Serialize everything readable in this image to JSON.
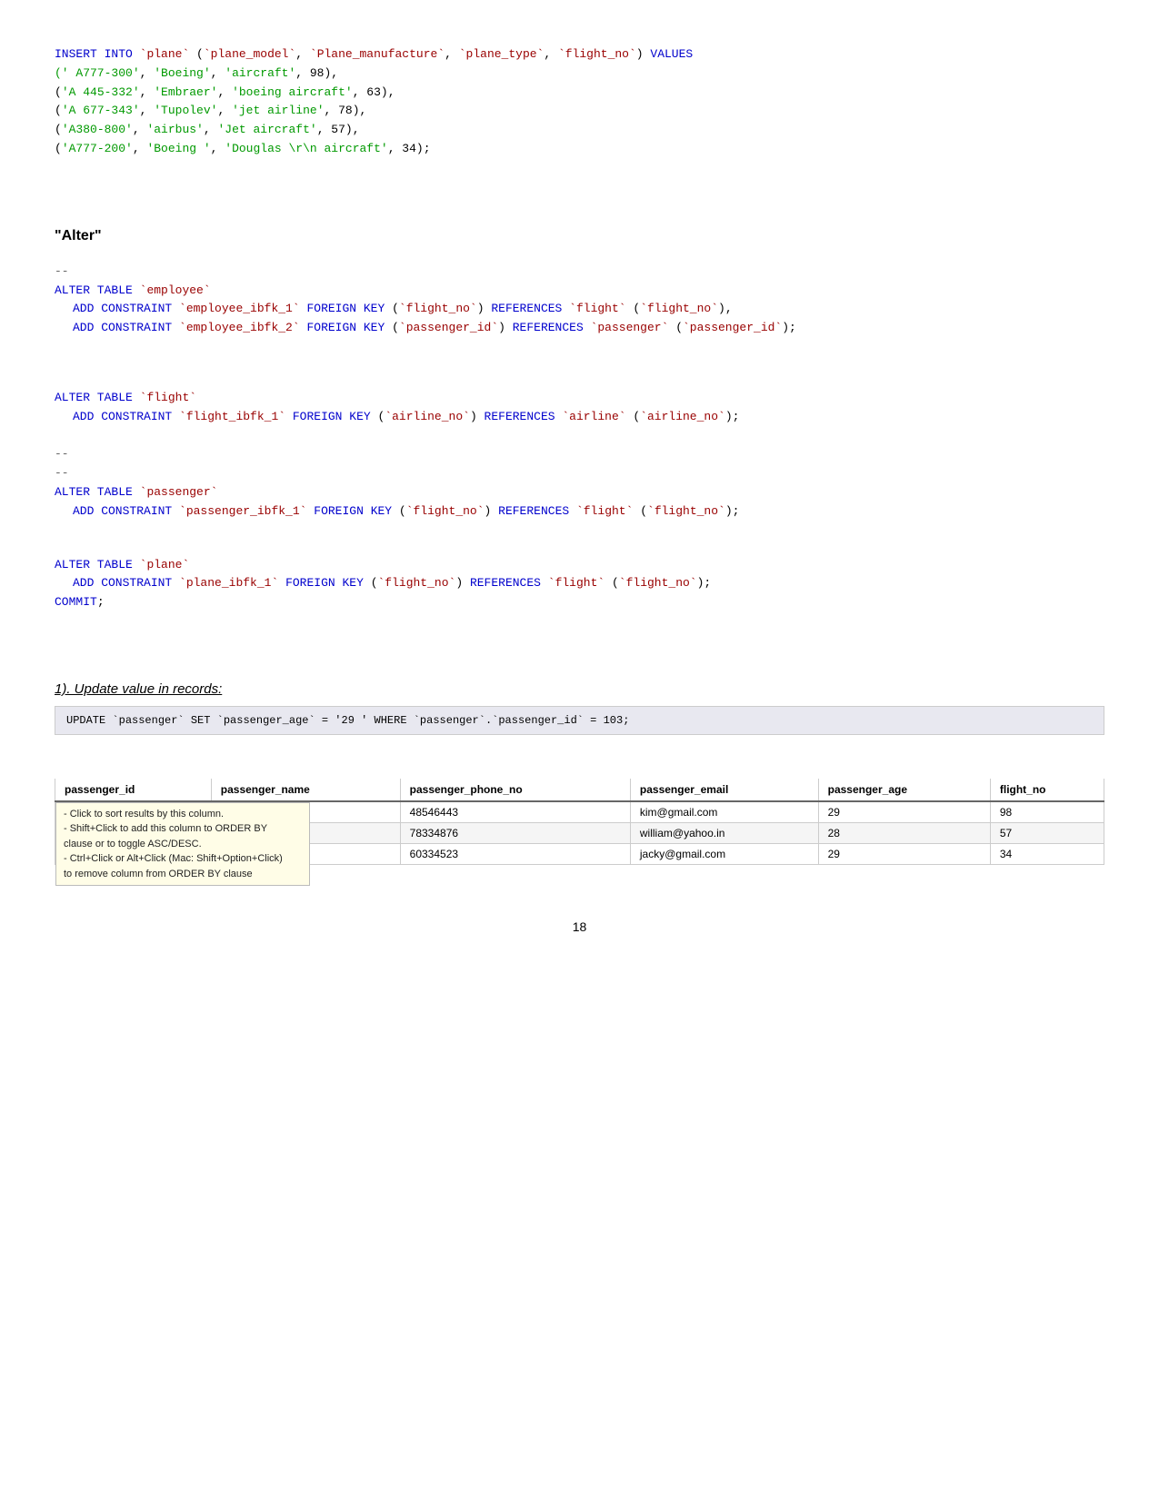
{
  "page": {
    "number": "18"
  },
  "insert_block": {
    "line1": "INSERT INTO `plane` (`plane_model`, `Plane_manufacture`, `plane_type`, `flight_no`) VALUES",
    "line2": "(' A777-300', 'Boeing', 'aircraft', 98),",
    "line3": "('A 445-332', 'Embraer', 'boeing aircraft', 63),",
    "line4": "('A 677-343', 'Tupolev', 'jet airline', 78),",
    "line5": "('A380-800', 'airbus', 'Jet aircraft', 57),",
    "line6": "('A777-200', 'Boeing ', 'Douglas \\r\\n aircraft', 34);"
  },
  "alter_heading": {
    "label": "\"Alter\""
  },
  "alter_blocks": {
    "comment1": "--",
    "block1_line1": "ALTER TABLE `employee`",
    "block1_line2": "  ADD CONSTRAINT `employee_ibfk_1` FOREIGN KEY (`flight_no`) REFERENCES `flight` (`flight_no`),",
    "block1_line3": "  ADD CONSTRAINT `employee_ibfk_2` FOREIGN KEY (`passenger_id`) REFERENCES `passenger` (`passenger_id`);",
    "block2_line1": "ALTER TABLE `flight`",
    "block2_line2": "  ADD CONSTRAINT `flight_ibfk_1` FOREIGN KEY (`airline_no`) REFERENCES `airline` (`airline_no`);",
    "comment2": "--",
    "comment3": "--",
    "block3_line1": "ALTER TABLE `passenger`",
    "block3_line2": "  ADD CONSTRAINT `passenger_ibfk_1` FOREIGN KEY (`flight_no`) REFERENCES `flight` (`flight_no`);",
    "block4_line1": "ALTER TABLE `plane`",
    "block4_line2": "  ADD CONSTRAINT `plane_ibfk_1` FOREIGN KEY (`flight_no`) REFERENCES `flight` (`flight_no`);",
    "commit": "COMMIT;"
  },
  "update_section": {
    "heading": "1).  Update value in records:",
    "query": "UPDATE `passenger` SET `passenger_age` = '29 ' WHERE `passenger`.`passenger_id` = 103;"
  },
  "table": {
    "headers": [
      "passenger_id",
      "passenger_name",
      "passenger_phone_no",
      "passenger_email",
      "passenger_age",
      "flight_no"
    ],
    "tooltip": {
      "line1": "- Click to sort results by this column.",
      "line2": "- Shift+Click to add this column to ORDER BY",
      "line3": "  clause or to toggle ASC/DESC.",
      "line4": "- Ctrl+Click or Alt+Click (Mac: Shift+Option+Click)",
      "line5": "  to remove column from ORDER BY clause"
    },
    "rows": [
      {
        "passenger_id": "",
        "passenger_name": "",
        "passenger_phone_no": "48546443",
        "passenger_email": "kim@gmail.com",
        "passenger_age": "29",
        "flight_no": "98"
      },
      {
        "passenger_id": "",
        "passenger_name": "",
        "passenger_phone_no": "78334876",
        "passenger_email": "william@yahoo.in",
        "passenger_age": "28",
        "flight_no": "57"
      },
      {
        "passenger_id": "",
        "passenger_name": "",
        "passenger_phone_no": "60334523",
        "passenger_email": "jacky@gmail.com",
        "passenger_age": "29",
        "flight_no": "34"
      }
    ]
  }
}
